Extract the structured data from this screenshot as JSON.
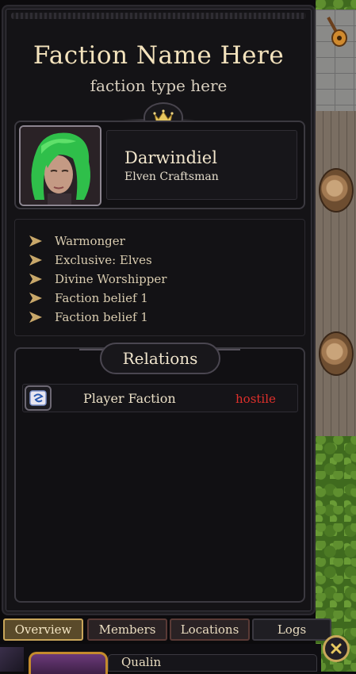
{
  "faction": {
    "name": "Faction Name Here",
    "type": "faction type here"
  },
  "leader": {
    "name": "Darwindiel",
    "title": "Elven Craftsman"
  },
  "beliefs": [
    "Warmonger",
    "Exclusive: Elves",
    "Divine Worshipper",
    "Faction belief 1",
    "Faction belief 1"
  ],
  "relations": {
    "header": "Relations",
    "rows": [
      {
        "name": "Player Faction",
        "status": "hostile",
        "status_color": "#e0302b"
      }
    ]
  },
  "tabs": [
    {
      "label": "Overview",
      "active": true
    },
    {
      "label": "Members",
      "active": false
    },
    {
      "label": "Locations",
      "active": false
    },
    {
      "label": "Logs",
      "active": false
    }
  ],
  "bottom": {
    "name": "Qualin"
  },
  "icons": {
    "crown": "crown-icon",
    "belief_bullet": "triangle-arrow-icon",
    "relation": "faction-emblem-icon",
    "close": "close-icon",
    "world_item": "lute-icon"
  },
  "colors": {
    "accent_gold": "#c9a85a",
    "hostile": "#e0302b"
  }
}
